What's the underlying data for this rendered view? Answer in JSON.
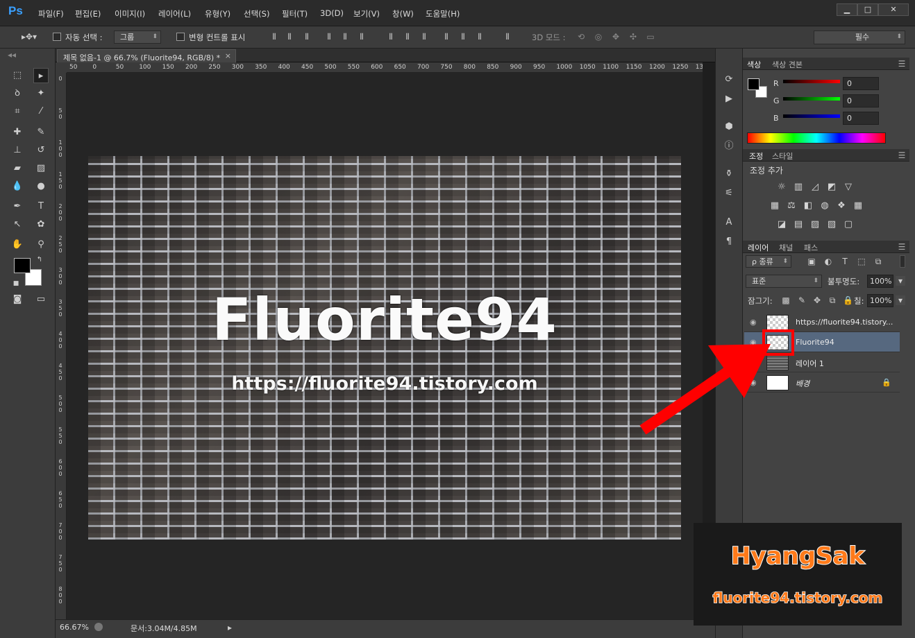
{
  "app": {
    "logo": "Ps"
  },
  "menu": [
    "파일(F)",
    "편집(E)",
    "이미지(I)",
    "레이어(L)",
    "유형(Y)",
    "선택(S)",
    "필터(T)",
    "3D(D)",
    "보기(V)",
    "창(W)",
    "도움말(H)"
  ],
  "window_controls": {
    "minimize": "▁",
    "maximize": "□",
    "close": "✕"
  },
  "options": {
    "auto_select_label": "자동 선택 :",
    "auto_select_value": "그룹",
    "transform_label": "변형 컨트롤 표시",
    "mode3d_label": "3D 모드 :",
    "workspace": "필수"
  },
  "document": {
    "tab_title": "제목 없음-1 @ 66.7% (Fluorite94, RGB/8) *",
    "tab_close": "×",
    "ruler_h": [
      "50",
      "0",
      "50",
      "100",
      "150",
      "200",
      "250",
      "300",
      "350",
      "400",
      "450",
      "500",
      "550",
      "600",
      "650",
      "700",
      "750",
      "800",
      "850",
      "900",
      "950",
      "1000",
      "1050",
      "1100",
      "1150",
      "1200",
      "1250",
      "130"
    ],
    "ruler_v": [
      "0",
      "50",
      "100",
      "150",
      "200",
      "250",
      "300",
      "350",
      "400",
      "450",
      "500",
      "550",
      "600",
      "650",
      "700",
      "750",
      "800"
    ],
    "image_title": "Fluorite94",
    "image_url": "https://fluorite94.tistory.com"
  },
  "status": {
    "zoom": "66.67%",
    "doc_info": "문서:3.04M/4.85M"
  },
  "color_panel": {
    "tabs": [
      "색상",
      "색상 견본"
    ],
    "channels": [
      {
        "label": "R",
        "value": "0"
      },
      {
        "label": "G",
        "value": "0"
      },
      {
        "label": "B",
        "value": "0"
      }
    ]
  },
  "adjust_panel": {
    "tabs": [
      "조정",
      "스타일"
    ],
    "add_label": "조정 추가"
  },
  "layers_panel": {
    "tabs": [
      "레이어",
      "채널",
      "패스"
    ],
    "filter_kind": "ρ 종류",
    "blend_mode": "표준",
    "opacity_label": "불투명도:",
    "opacity_value": "100%",
    "lock_label": "잠그기:",
    "fill_label": "칠:",
    "fill_value": "100%",
    "layers": [
      {
        "name": "https://fluorite94.tistory..."
      },
      {
        "name": "Fluorite94"
      },
      {
        "name": "레이어 1"
      },
      {
        "name": "배경"
      }
    ]
  },
  "watermark": {
    "name": "HyangSak",
    "url": "fluorite94.tistory.com"
  },
  "colors": {
    "accent_blue": "#3aa0ff",
    "annotation_red": "#ff0000",
    "watermark_orange": "#ff7a1a",
    "selected_layer": "#56687f"
  }
}
